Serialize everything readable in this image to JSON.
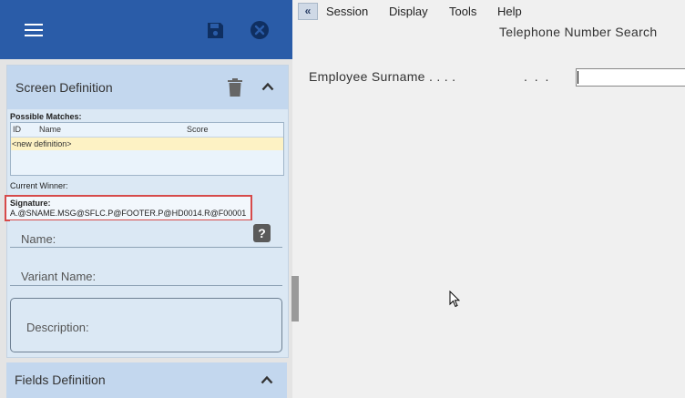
{
  "left_panel": {
    "screen_definition": {
      "title": "Screen Definition",
      "possible_matches_label": "Possible Matches:",
      "columns": [
        "ID",
        "Name",
        "Score"
      ],
      "rows": [
        "<new definition>"
      ],
      "current_winner_label": "Current Winner:",
      "signature_label": "Signature:",
      "signature_value": "A.@SNAME.MSG@SFLC.P@FOOTER.P@HD0014.R@F00001",
      "name_placeholder": "Name:",
      "help_glyph": "?",
      "variant_placeholder": "Variant Name:",
      "description_placeholder": "Description:"
    },
    "fields_definition": {
      "title": "Fields Definition"
    }
  },
  "menu": {
    "collapse_glyph": "«",
    "items": [
      "Session",
      "Display",
      "Tools",
      "Help"
    ]
  },
  "screen": {
    "title": "Telephone Number Search",
    "employee_label": "Employee Surname . . . .",
    "employee_dots": ". . .",
    "employee_value": ""
  },
  "icons": {
    "menu": "hamburger-icon",
    "save": "save-icon",
    "close": "close-circle-icon",
    "delete": "trash-icon",
    "collapse_panel": "chevron-up-icon",
    "help": "help-icon",
    "collapse_left": "double-chevron-left-icon",
    "cursor": "mouse-pointer-icon"
  },
  "colors": {
    "header_blue": "#2a5ca8",
    "panel_header": "#c3d7ee",
    "highlight_row": "#fdf2c4",
    "signature_border": "#d64a4a"
  }
}
